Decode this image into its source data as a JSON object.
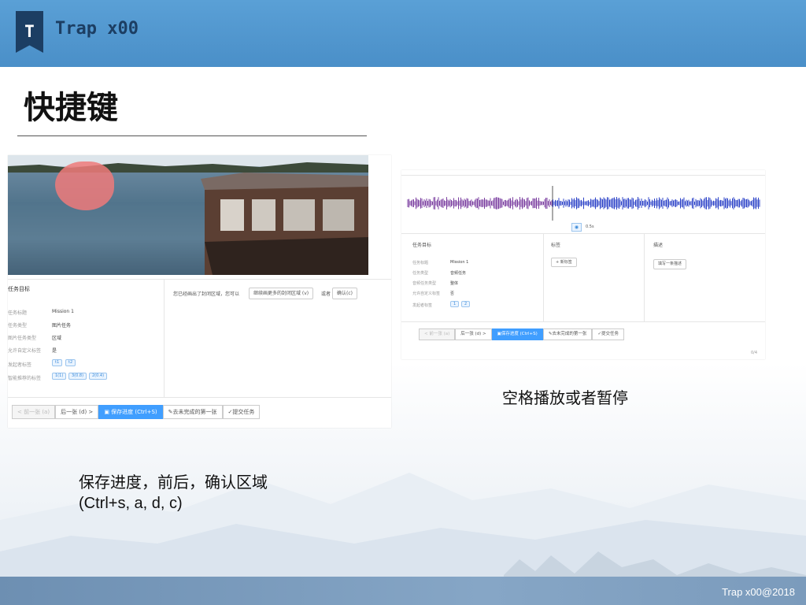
{
  "header": {
    "logo_letter": "T",
    "brand": "Trap x00"
  },
  "slide": {
    "title": "快捷键",
    "caption_left_line1": "保存进度，前后，确认区域",
    "caption_left_line2": "(Ctrl+s, a, d,  c)",
    "caption_right": "空格播放或者暂停",
    "footer": "Trap x00@2018"
  },
  "shot_left": {
    "panel_title": "任务目标",
    "fields": [
      {
        "label": "任务标题",
        "value": "Mission 1"
      },
      {
        "label": "任务类型",
        "value": "图片任务"
      },
      {
        "label": "图片任务类型",
        "value": "区域"
      },
      {
        "label": "允许自定义标签",
        "value": "是"
      },
      {
        "label": "发起者标签",
        "value": ""
      },
      {
        "label": "智能推荐的标签",
        "value": ""
      }
    ],
    "owner_tags": [
      "t1",
      "t2"
    ],
    "smart_tags": [
      "1(1)",
      "3(0.8)",
      "2(0.4)"
    ],
    "hint": "您已经画出了封闭区域，您可以",
    "continue_btn": "继续画更多的封闭区域 (v)",
    "or_text": "或者",
    "confirm_btn": "确认(c)",
    "buttons": [
      "< 前一张 (a)",
      "后一张 (d) >",
      "保存进度 (Ctrl+S)",
      "去未完成的第一张",
      "提交任务"
    ]
  },
  "shot_right": {
    "play_label": "0.5s",
    "panel_titles": [
      "任务目标",
      "标签",
      "描述"
    ],
    "fields": [
      {
        "label": "任务标题",
        "value": "Mission 1"
      },
      {
        "label": "任务类型",
        "value": "音频任务"
      },
      {
        "label": "音频任务类型",
        "value": "整体"
      },
      {
        "label": "允许自定义标签",
        "value": "否"
      },
      {
        "label": "发起者标签",
        "value": ""
      }
    ],
    "owner_tags": [
      "1",
      "2"
    ],
    "add_tag": "+ 新标签",
    "add_desc": "填写一条描述",
    "buttons": [
      "< 前一张 (a)",
      "后一张 (d) >",
      "保存进度 (Ctrl+S)",
      "去未完成的第一张",
      "提交任务"
    ],
    "page": "0/4"
  },
  "colors": {
    "header": "#5aa0d6",
    "brand": "#1c3e63",
    "primary": "#409eff",
    "wave_a": "#7b3fa0",
    "wave_b": "#2f45c8"
  },
  "icons": [
    "bookmark-logo-icon",
    "save-icon",
    "edit-icon",
    "check-icon",
    "play-icon"
  ]
}
